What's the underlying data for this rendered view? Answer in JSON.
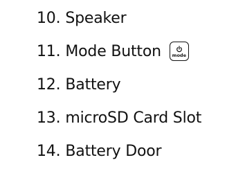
{
  "parts": [
    {
      "number": "10.",
      "label": "Speaker"
    },
    {
      "number": "11.",
      "label": "Mode Button",
      "icon": "power-mode-icon",
      "icon_text": "mode"
    },
    {
      "number": "12.",
      "label": "Battery"
    },
    {
      "number": "13.",
      "label": "microSD Card Slot"
    },
    {
      "number": "14.",
      "label": "Battery Door"
    }
  ],
  "colors": {
    "text": "#111111",
    "background": "#ffffff"
  }
}
